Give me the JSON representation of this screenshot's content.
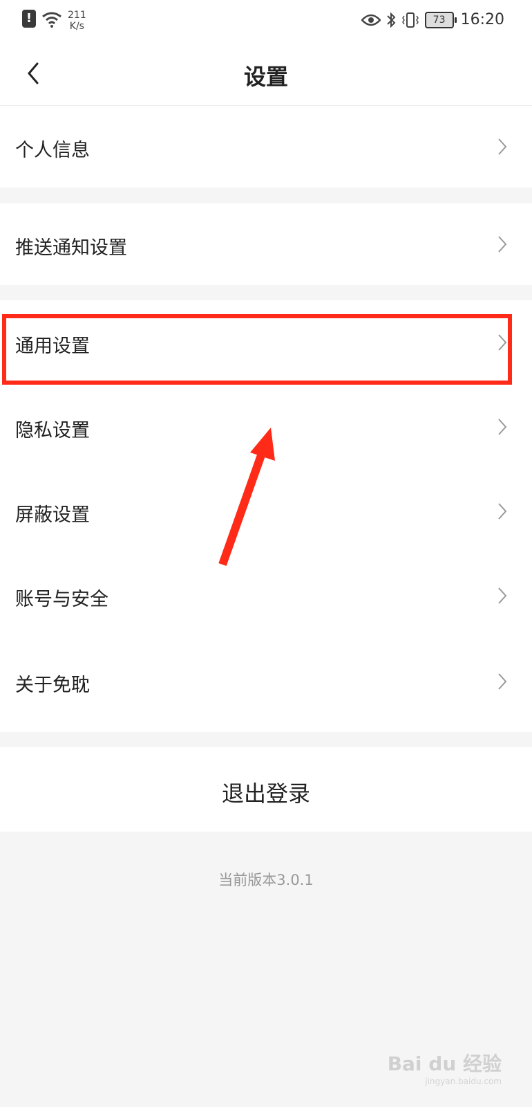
{
  "status_bar": {
    "net_speed_value": "211",
    "net_speed_unit": "K/s",
    "battery": "73",
    "time": "16:20"
  },
  "header": {
    "title": "设置"
  },
  "menu": [
    {
      "label": "个人信息"
    },
    {
      "label": "推送通知设置"
    },
    {
      "label": "通用设置"
    },
    {
      "label": "隐私设置"
    },
    {
      "label": "屏蔽设置"
    },
    {
      "label": "账号与安全"
    },
    {
      "label": "关于免耽"
    }
  ],
  "logout": {
    "label": "退出登录"
  },
  "footer": {
    "version_text": "当前版本3.0.1"
  },
  "watermark": {
    "brand": "Bai du 经验",
    "url": "jingyan.baidu.com"
  },
  "colors": {
    "highlight": "#ff2a17",
    "background": "#f5f5f5",
    "row": "#ffffff"
  }
}
